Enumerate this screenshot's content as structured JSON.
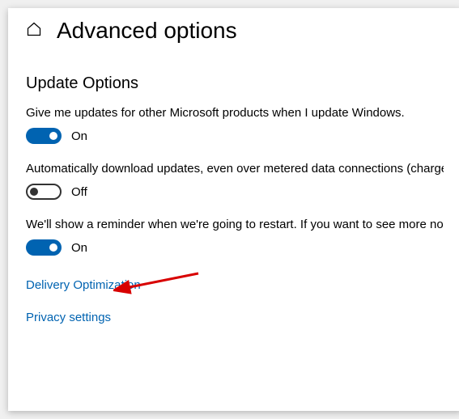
{
  "header": {
    "title": "Advanced options"
  },
  "section": {
    "heading": "Update Options"
  },
  "settings": [
    {
      "description": "Give me updates for other Microsoft products when I update Windows.",
      "state": "On",
      "on": true
    },
    {
      "description": "Automatically download updates, even over metered data connections (charges may apply).",
      "state": "Off",
      "on": false
    },
    {
      "description": "We'll show a reminder when we're going to restart. If you want to see more notifications about restarting, turn this on.",
      "state": "On",
      "on": true
    }
  ],
  "links": [
    {
      "label": "Delivery Optimization"
    },
    {
      "label": "Privacy settings"
    }
  ],
  "annotation": {
    "arrow_color": "#d80000"
  }
}
